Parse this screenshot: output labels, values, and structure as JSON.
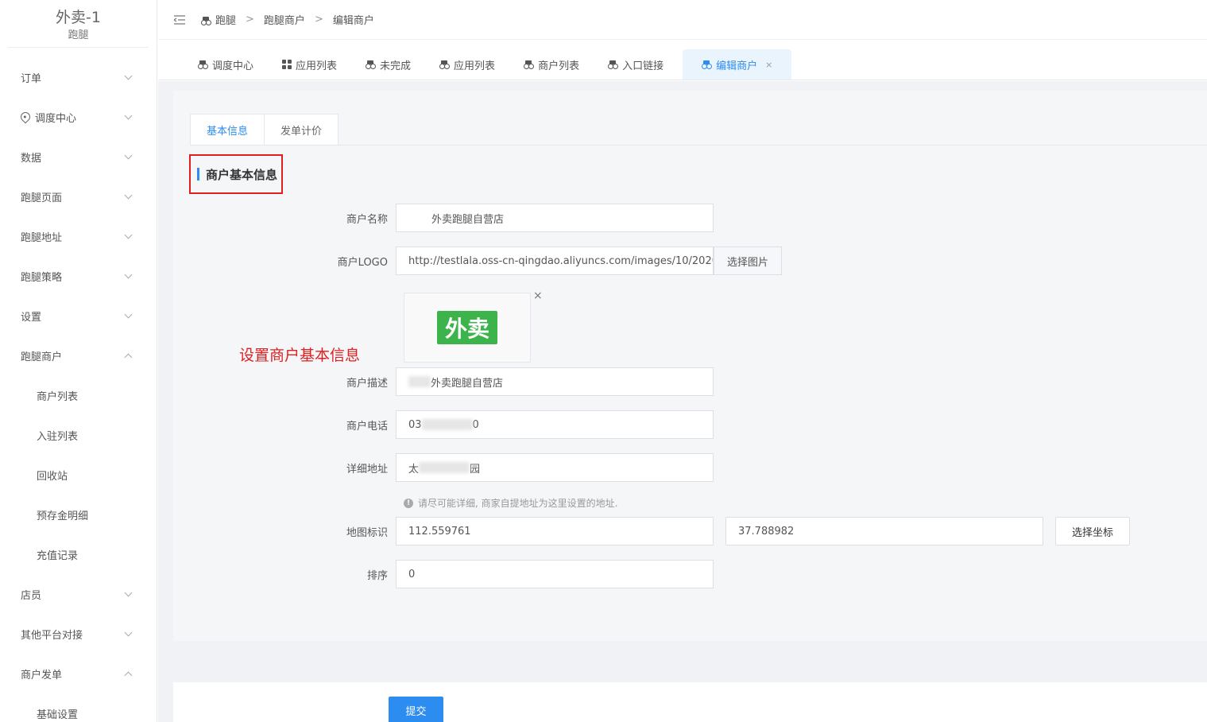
{
  "sidebar": {
    "title": "外卖-1",
    "subtitle": "跑腿",
    "items": [
      {
        "label": "订单",
        "type": "top",
        "chevron": "down"
      },
      {
        "label": "调度中心",
        "type": "top",
        "chevron": "down",
        "icon": "location-pin-icon"
      },
      {
        "label": "数据",
        "type": "top",
        "chevron": "down"
      },
      {
        "label": "跑腿页面",
        "type": "top",
        "chevron": "down"
      },
      {
        "label": "跑腿地址",
        "type": "top",
        "chevron": "down"
      },
      {
        "label": "跑腿策略",
        "type": "top",
        "chevron": "down"
      },
      {
        "label": "设置",
        "type": "top",
        "chevron": "down"
      },
      {
        "label": "跑腿商户",
        "type": "top",
        "chevron": "up"
      },
      {
        "label": "商户列表",
        "type": "sub"
      },
      {
        "label": "入驻列表",
        "type": "sub"
      },
      {
        "label": "回收站",
        "type": "sub"
      },
      {
        "label": "预存金明细",
        "type": "sub"
      },
      {
        "label": "充值记录",
        "type": "sub"
      },
      {
        "label": "店员",
        "type": "top",
        "chevron": "down"
      },
      {
        "label": "其他平台对接",
        "type": "top",
        "chevron": "down"
      },
      {
        "label": "商户发单",
        "type": "top",
        "chevron": "up"
      },
      {
        "label": "基础设置",
        "type": "sub"
      }
    ]
  },
  "breadcrumb": {
    "items": [
      "跑腿",
      "跑腿商户",
      "编辑商户"
    ],
    "separator": ">"
  },
  "tabs": [
    {
      "label": "调度中心",
      "icon": "moped-icon"
    },
    {
      "label": "应用列表",
      "icon": "grid-icon"
    },
    {
      "label": "未完成",
      "icon": "moped-icon"
    },
    {
      "label": "应用列表",
      "icon": "moped-icon"
    },
    {
      "label": "商户列表",
      "icon": "moped-icon"
    },
    {
      "label": "入口链接",
      "icon": "moped-icon"
    },
    {
      "label": "编辑商户",
      "icon": "moped-icon",
      "active": true,
      "close": "×"
    }
  ],
  "subtabs": [
    "基本信息",
    "发单计价"
  ],
  "section_title": "商户基本信息",
  "annotation": "设置商户基本信息",
  "form": {
    "name_label": "商户名称",
    "name_value": "外卖跑腿自营店",
    "logo_label": "商户LOGO",
    "logo_value": "http://testlala.oss-cn-qingdao.aliyuncs.com/images/10/2020/",
    "logo_button": "选择图片",
    "logo_image_text": "外卖",
    "logo_remove": "×",
    "desc_label": "商户描述",
    "desc_value": "外卖跑腿自营店",
    "phone_label": "商户电话",
    "phone_prefix": "03",
    "phone_suffix": "0",
    "address_label": "详细地址",
    "address_prefix": "太",
    "address_suffix": "园",
    "address_hint": "请尽可能详细, 商家自提地址为这里设置的地址.",
    "map_label": "地图标识",
    "lng_value": "112.559761",
    "lat_value": "37.788982",
    "map_button": "选择坐标",
    "sort_label": "排序",
    "sort_value": "0"
  },
  "submit_label": "提交",
  "colors": {
    "primary": "#2d8cf0",
    "annotation": "#e02020",
    "logo_green": "#3cb44b"
  }
}
